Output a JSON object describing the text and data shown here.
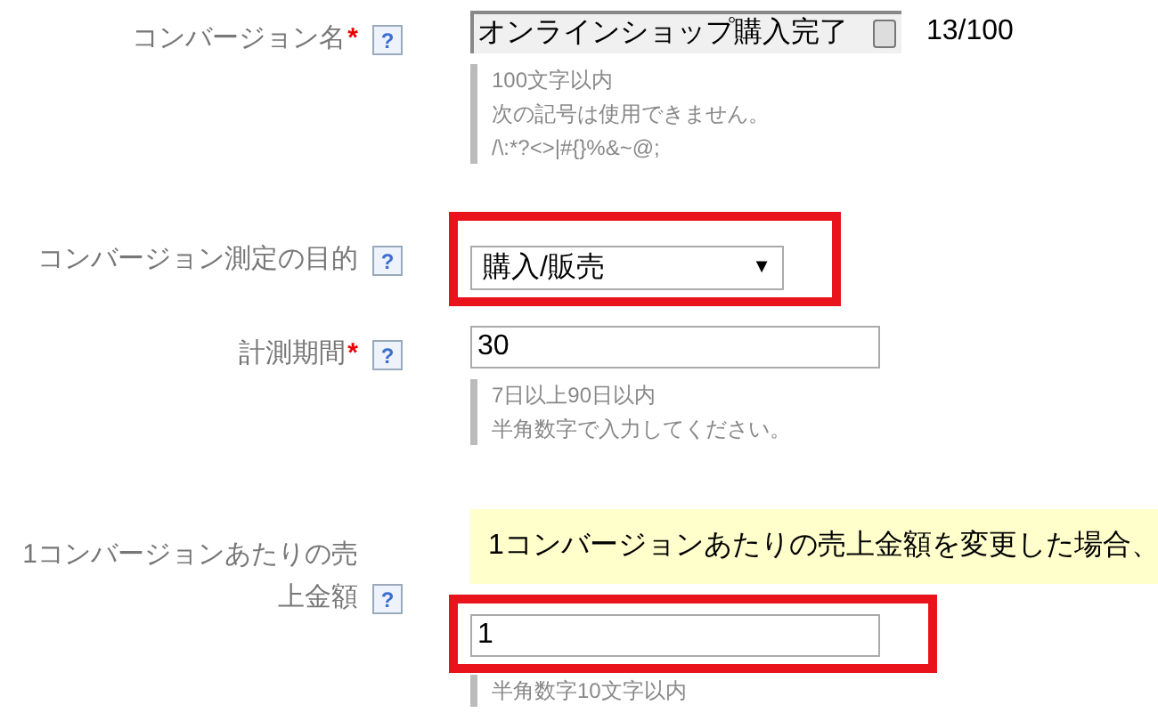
{
  "fields": [
    {
      "kind": "text",
      "label": "コンバージョン名",
      "required": true,
      "highlighted": false,
      "value": "オンラインショップ購入完了",
      "counter": "13/100",
      "hints": [
        "100文字以内",
        "次の記号は使用できません。",
        "/\\:*?<>|#{}%&~@;"
      ]
    },
    {
      "kind": "select",
      "label": "コンバージョン測定の目的",
      "required": false,
      "highlighted": true,
      "value": "購入/販売",
      "caret": "▼"
    },
    {
      "kind": "input",
      "label": "計測期間",
      "required": true,
      "highlighted": false,
      "value": "30",
      "hints": [
        "7日以上90日以内",
        "半角数字で入力してください。"
      ]
    },
    {
      "kind": "input",
      "label": "1コンバージョンあたりの売上金額",
      "required": false,
      "highlighted": true,
      "notice": "1コンバージョンあたりの売上金額を変更した場合、",
      "value": "1",
      "hints": [
        "半角数字10文字以内"
      ]
    }
  ],
  "required_mark": "*",
  "help_mark": "?"
}
